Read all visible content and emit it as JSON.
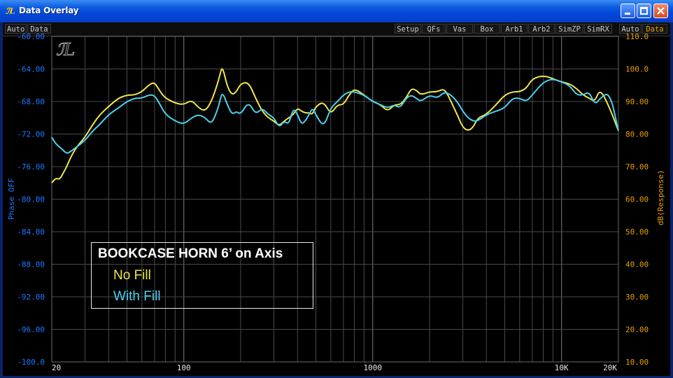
{
  "window": {
    "title": "Data Overlay"
  },
  "toolbar": {
    "left": [
      "Auto",
      "Data"
    ],
    "middle": [
      "Setup",
      "QFs",
      "Vas",
      "Box",
      "Arb1",
      "Arb2",
      "SimZP",
      "SimRX"
    ],
    "right": [
      "Auto",
      "Data"
    ]
  },
  "colors": {
    "left_axis": "#1e78ff",
    "right_axis": "#e8a000",
    "no_fill": "#f0e64a",
    "with_fill": "#4ad2f0",
    "grid": "#4a4a4a"
  },
  "legend": {
    "title": "BOOKCASE HORN 6’ on Axis",
    "items": [
      {
        "label": "No Fill",
        "color": "#f0e64a"
      },
      {
        "label": "With Fill",
        "color": "#4ad2f0"
      }
    ]
  },
  "chart_data": {
    "type": "line",
    "x_scale": "log",
    "xlim": [
      20,
      20000
    ],
    "x_tick_labels": [
      "20",
      "100",
      "1000",
      "10K",
      "20K"
    ],
    "left_axis": {
      "label": "Phase OFF",
      "range": [
        -100,
        -60
      ],
      "ticks": [
        "-60.00",
        "-64.00",
        "-68.00",
        "-72.00",
        "-76.00",
        "-80.00",
        "-84.00",
        "-88.00",
        "-92.00",
        "-96.00",
        "-100.0"
      ]
    },
    "right_axis": {
      "label": "dB(Response)",
      "range": [
        10,
        110
      ],
      "ticks": [
        "110.0",
        "100.0",
        "90.00",
        "80.00",
        "70.00",
        "60.00",
        "50.00",
        "40.00",
        "30.00",
        "20.00",
        "10.00"
      ]
    },
    "grid": true,
    "series": [
      {
        "name": "No Fill",
        "color": "#f0e64a",
        "x": [
          20,
          21,
          22,
          23,
          24,
          25,
          27,
          30,
          33,
          36,
          40,
          45,
          50,
          55,
          60,
          65,
          70,
          75,
          80,
          90,
          100,
          110,
          120,
          130,
          140,
          150,
          155,
          160,
          170,
          180,
          190,
          200,
          220,
          240,
          260,
          280,
          300,
          320,
          340,
          360,
          380,
          400,
          420,
          440,
          460,
          480,
          500,
          550,
          600,
          650,
          700,
          750,
          800,
          900,
          1000,
          1100,
          1200,
          1300,
          1400,
          1500,
          1600,
          1700,
          1800,
          2000,
          2200,
          2400,
          2600,
          2800,
          3000,
          3200,
          3400,
          3600,
          4000,
          4500,
          5000,
          5500,
          6000,
          6500,
          7000,
          8000,
          9000,
          10000,
          11000,
          12000,
          13000,
          14000,
          15000,
          16000,
          18000,
          20000
        ],
        "y": [
          65,
          66.5,
          66,
          68,
          70,
          72.5,
          76,
          79,
          83,
          86,
          88.5,
          91,
          92,
          92,
          93,
          95,
          96,
          93,
          91,
          89.5,
          89,
          90.5,
          88,
          87,
          90,
          95,
          98,
          101,
          94.5,
          92,
          93,
          95.5,
          96,
          91,
          87,
          85,
          84,
          82.5,
          84,
          85,
          86,
          88,
          87,
          86.5,
          86.5,
          86,
          88.5,
          90,
          86,
          89,
          89,
          92,
          94,
          92,
          90,
          89,
          87,
          89,
          89,
          91,
          94,
          93.5,
          92,
          93,
          93,
          94,
          90,
          86,
          82,
          81,
          82,
          85,
          86,
          89,
          92,
          93,
          93,
          94,
          97,
          98,
          97,
          96,
          95.5,
          94,
          92,
          91,
          90,
          94,
          88,
          81
        ]
      },
      {
        "name": "With Fill",
        "color": "#4ad2f0",
        "x": [
          20,
          21,
          22,
          23,
          24,
          25,
          27,
          30,
          33,
          36,
          40,
          45,
          50,
          55,
          60,
          65,
          70,
          75,
          80,
          90,
          100,
          110,
          120,
          130,
          140,
          150,
          155,
          160,
          170,
          180,
          190,
          200,
          220,
          240,
          260,
          280,
          300,
          320,
          340,
          360,
          380,
          400,
          420,
          440,
          460,
          480,
          500,
          550,
          600,
          650,
          700,
          750,
          800,
          900,
          1000,
          1100,
          1200,
          1300,
          1400,
          1500,
          1600,
          1700,
          1800,
          2000,
          2200,
          2400,
          2600,
          2800,
          3000,
          3200,
          3400,
          3600,
          4000,
          4500,
          5000,
          5500,
          6000,
          6500,
          7000,
          8000,
          9000,
          10000,
          11000,
          12000,
          13000,
          14000,
          15000,
          16000,
          18000,
          20000
        ],
        "y": [
          79,
          77,
          76,
          75,
          74,
          74.5,
          76,
          78,
          81,
          83,
          86,
          88,
          90,
          91,
          91,
          92,
          92,
          89,
          86,
          84,
          83,
          85,
          86,
          85,
          83,
          87,
          90,
          93,
          89,
          86,
          87,
          86,
          90,
          86,
          88,
          86,
          85,
          82,
          84,
          83,
          88,
          86,
          83,
          84,
          86,
          88,
          86,
          82,
          88,
          90,
          92,
          93,
          93,
          92,
          90,
          89,
          88,
          89,
          88,
          91,
          92,
          91,
          90,
          92,
          91,
          93,
          92,
          90,
          87,
          85,
          84,
          84,
          86,
          87,
          88,
          91,
          91,
          90,
          92,
          96,
          97,
          96,
          95,
          92,
          92,
          93,
          89,
          91,
          93,
          81
        ]
      }
    ]
  }
}
